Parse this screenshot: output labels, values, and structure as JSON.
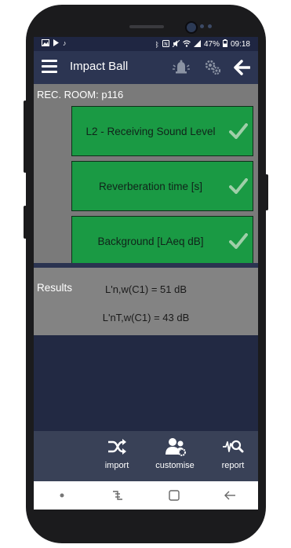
{
  "status_bar": {
    "battery": "47%",
    "time": "09:18"
  },
  "app_bar": {
    "title": "Impact Ball"
  },
  "room": {
    "label": "REC. ROOM: p116"
  },
  "steps": [
    {
      "label": "L2 - Receiving Sound Level",
      "completed": true
    },
    {
      "label": "Reverberation time [s]",
      "completed": true
    },
    {
      "label": "Background [LAeq dB]",
      "completed": true
    }
  ],
  "results": {
    "title": "Results",
    "values": [
      "L'n,w(C1) = 51 dB",
      "L'nT,w(C1) = 43 dB"
    ]
  },
  "toolbar": {
    "items": [
      {
        "label": "import",
        "icon": "shuffle-icon"
      },
      {
        "label": "customise",
        "icon": "users-gear-icon"
      },
      {
        "label": "report",
        "icon": "waveform-search-icon"
      }
    ]
  },
  "colors": {
    "app_bar": "#2c3552",
    "step_green": "#1a9a44",
    "panel_gray": "#7a7a7a",
    "background_navy": "#222943"
  }
}
